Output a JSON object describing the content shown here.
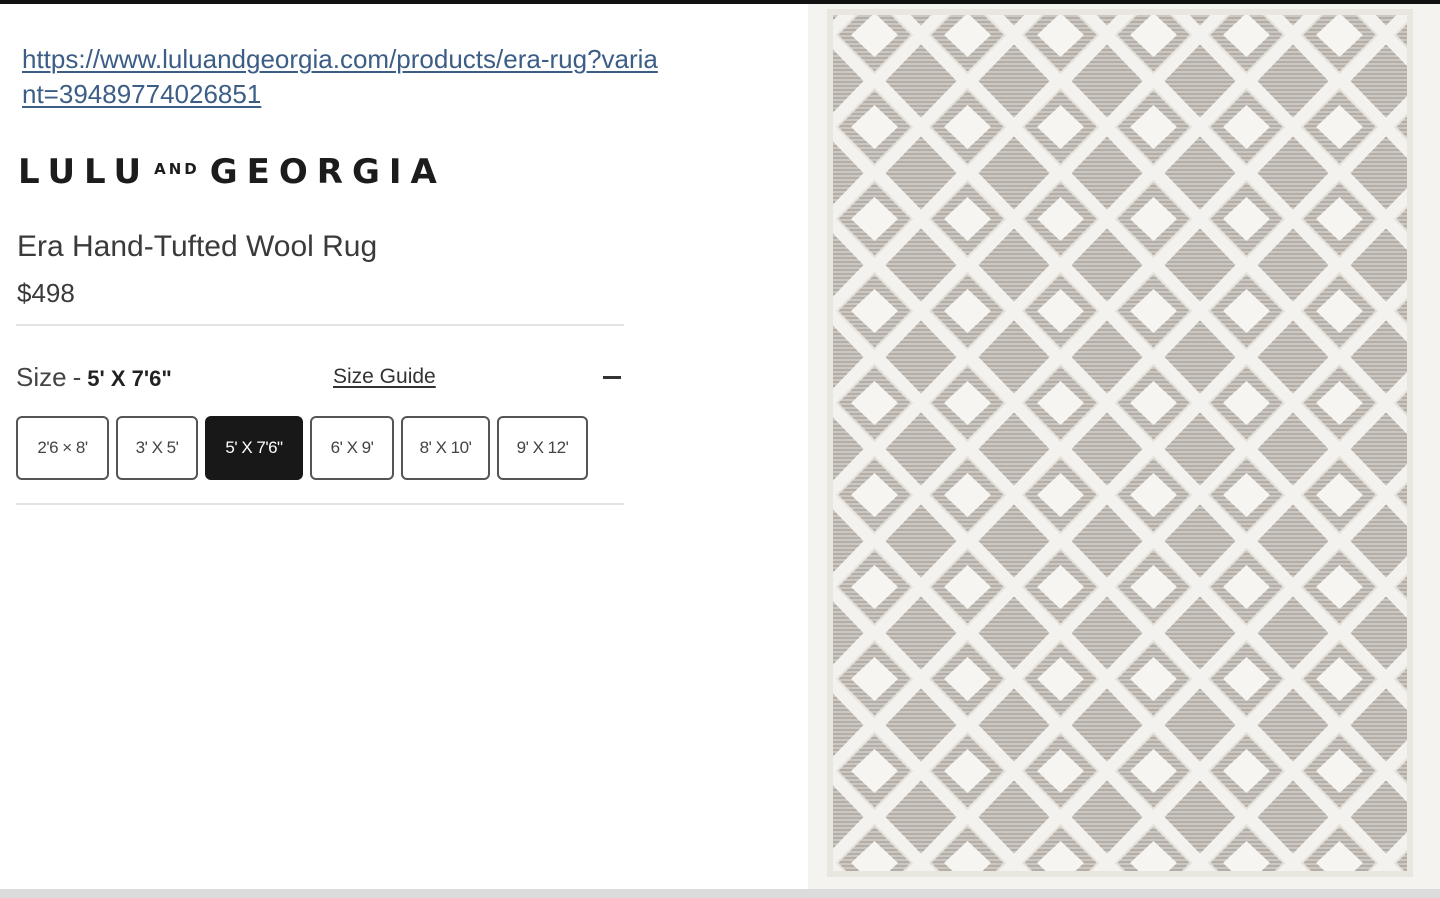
{
  "page": {
    "product_url": "https://www.luluandgeorgia.com/products/era-rug?variant=39489774026851"
  },
  "brand": {
    "word1": "LULU",
    "and": "AND",
    "word2": "GEORGIA"
  },
  "product": {
    "title": "Era Hand-Tufted Wool Rug",
    "price": "$498"
  },
  "size_selector": {
    "label": "Size",
    "separator": "-",
    "selected_value": "5' X 7'6\"",
    "size_guide_label": "Size Guide",
    "options": [
      {
        "label": "2'6 × 8'",
        "selected": false
      },
      {
        "label": "3' X 5'",
        "selected": false
      },
      {
        "label": "5' X 7'6\"",
        "selected": true
      },
      {
        "label": "6' X 9'",
        "selected": false
      },
      {
        "label": "8' X 10'",
        "selected": false
      },
      {
        "label": "9' X 12'",
        "selected": false
      }
    ]
  },
  "colors": {
    "link": "#3c5d86",
    "selected_option_bg": "#181818",
    "rug_cream": "#f4f2ee",
    "rug_grey": "#b9b5ae"
  },
  "icons": {
    "collapse_toggle": "minus-icon"
  }
}
